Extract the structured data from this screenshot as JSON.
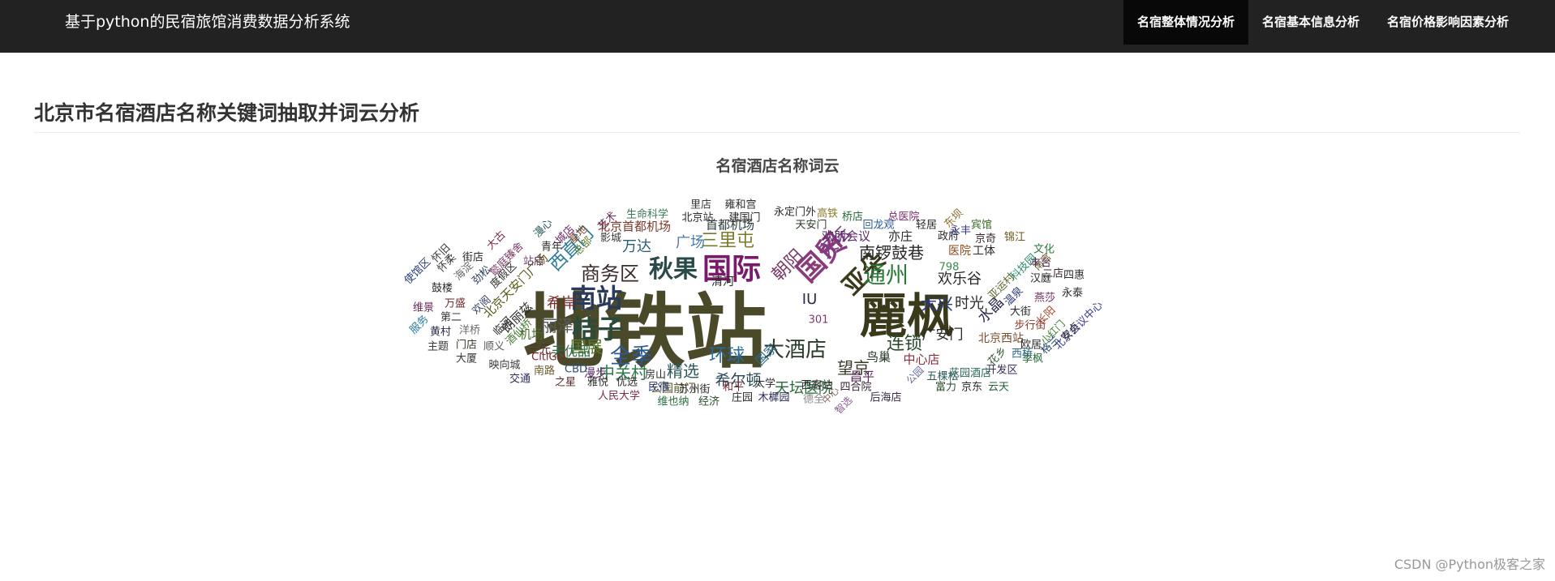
{
  "header": {
    "brand": "基于python的民宿旅馆消费数据分析系统",
    "nav": [
      {
        "label": "名宿整体情况分析"
      },
      {
        "label": "名宿基本信息分析"
      },
      {
        "label": "名宿价格影响因素分析"
      }
    ],
    "active_nav": 0
  },
  "main": {
    "title": "北京市名宿酒店名称关键词抽取并词云分析"
  },
  "chart_data": {
    "type": "wordcloud",
    "title": "名宿酒店名称词云",
    "words": [
      {
        "text": "地铁站",
        "weight": 100,
        "color": "#4a4a2a"
      },
      {
        "text": "麗枫",
        "weight": 58,
        "color": "#3a3a1a"
      },
      {
        "text": "国际",
        "weight": 36,
        "color": "#7a1a6a"
      },
      {
        "text": "国贸",
        "weight": 34,
        "color": "#8a3a7a"
      },
      {
        "text": "亚朵",
        "weight": 30,
        "color": "#3a3a1a"
      },
      {
        "text": "南站",
        "weight": 32,
        "color": "#2a3a5a"
      },
      {
        "text": "桔子",
        "weight": 32,
        "color": "#2a4a3a"
      },
      {
        "text": "秋果",
        "weight": 30,
        "color": "#2a4a4a"
      },
      {
        "text": "商务区",
        "weight": 24,
        "color": "#3a2a2a"
      },
      {
        "text": "通州",
        "weight": 28,
        "color": "#2a7a3a"
      },
      {
        "text": "全季",
        "weight": 26,
        "color": "#2a5a9a"
      },
      {
        "text": "大酒店",
        "weight": 26,
        "color": "#2a3a2a"
      },
      {
        "text": "三里屯",
        "weight": 22,
        "color": "#7a7a2a"
      },
      {
        "text": "朝阳",
        "weight": 22,
        "color": "#7a3a6a"
      },
      {
        "text": "天坛",
        "weight": 22,
        "color": "#7a3a8a"
      },
      {
        "text": "西直门",
        "weight": 22,
        "color": "#2a7a9a"
      },
      {
        "text": "南锣鼓巷",
        "weight": 20,
        "color": "#2a2a2a"
      },
      {
        "text": "大兴",
        "weight": 20,
        "color": "#2a3a8a"
      },
      {
        "text": "环球",
        "weight": 22,
        "color": "#2a6a9a"
      },
      {
        "text": "连锁",
        "weight": 22,
        "color": "#2a4a2a"
      },
      {
        "text": "丽泽",
        "weight": 20,
        "color": "#5a5a5a"
      },
      {
        "text": "国展",
        "weight": 20,
        "color": "#5a7a2a"
      },
      {
        "text": "中关村",
        "weight": 20,
        "color": "#2a7a4a"
      },
      {
        "text": "精选",
        "weight": 20,
        "color": "#2a5a5a"
      },
      {
        "text": "希尔顿",
        "weight": 19,
        "color": "#2a4a5a"
      },
      {
        "text": "望京",
        "weight": 20,
        "color": "#3a3a2a"
      },
      {
        "text": "万达",
        "weight": 18,
        "color": "#2a5a7a"
      },
      {
        "text": "广场",
        "weight": 18,
        "color": "#4a7aaa"
      },
      {
        "text": "水晶",
        "weight": 18,
        "color": "#2a2a4a"
      },
      {
        "text": "欢乐谷",
        "weight": 18,
        "color": "#2a2a2a"
      },
      {
        "text": "时光",
        "weight": 18,
        "color": "#2a2a2a"
      },
      {
        "text": "希岸",
        "weight": 18,
        "color": "#7a2a2a"
      },
      {
        "text": "天坛医院",
        "weight": 18,
        "color": "#2a6a3a"
      },
      {
        "text": "广安门",
        "weight": 17,
        "color": "#2a2a2a"
      },
      {
        "text": "天优品",
        "weight": 16,
        "color": "#2a6a4a"
      },
      {
        "text": "北京首都机场",
        "weight": 15,
        "color": "#7a3a2a"
      },
      {
        "text": "首都机场",
        "weight": 15,
        "color": "#2a3a3a"
      },
      {
        "text": "欢朋会议",
        "weight": 15,
        "color": "#5a2a6a"
      },
      {
        "text": "亦庄",
        "weight": 15,
        "color": "#2a2a2a"
      },
      {
        "text": "北京天安门广场",
        "weight": 15,
        "color": "#5a5a1a"
      },
      {
        "text": "朗丽兹",
        "weight": 15,
        "color": "#2a2a2a"
      },
      {
        "text": "机场",
        "weight": 15,
        "color": "#4a6a2a"
      },
      {
        "text": "中心店",
        "weight": 15,
        "color": "#8a2a3a"
      },
      {
        "text": "鸟巢",
        "weight": 15,
        "color": "#2a3a2a"
      },
      {
        "text": "昌平",
        "weight": 15,
        "color": "#5a2a5a"
      },
      {
        "text": "北京西站",
        "weight": 14,
        "color": "#7a4a2a"
      },
      {
        "text": "国家",
        "weight": 15,
        "color": "#2a6a8a"
      },
      {
        "text": "公园前门",
        "weight": 14,
        "color": "#5a5a2a"
      },
      {
        "text": "漫步",
        "weight": 14,
        "color": "#5a2a6a"
      },
      {
        "text": "三元",
        "weight": 14,
        "color": "#5a2a2a"
      },
      {
        "text": "工体",
        "weight": 14,
        "color": "#2a2a2a"
      },
      {
        "text": "医院",
        "weight": 14,
        "color": "#8a4a1a"
      },
      {
        "text": "政府",
        "weight": 13,
        "color": "#2a2a2a"
      },
      {
        "text": "轻居",
        "weight": 13,
        "color": "#2a2a2a"
      },
      {
        "text": "总医院",
        "weight": 13,
        "color": "#7a2a6a"
      },
      {
        "text": "回龙观",
        "weight": 13,
        "color": "#2a5a9a"
      },
      {
        "text": "桥店",
        "weight": 13,
        "color": "#2a6a3a"
      },
      {
        "text": "高铁",
        "weight": 13,
        "color": "#8a7a2a"
      },
      {
        "text": "东坝",
        "weight": 13,
        "color": "#8a6a2a"
      },
      {
        "text": "宾馆",
        "weight": 13,
        "color": "#3a6a2a"
      },
      {
        "text": "永丰",
        "weight": 13,
        "color": "#3a3a8a"
      },
      {
        "text": "京奇",
        "weight": 13,
        "color": "#3a2a2a"
      },
      {
        "text": "锦江",
        "weight": 13,
        "color": "#6a5a1a"
      },
      {
        "text": "文化",
        "weight": 13,
        "color": "#2a7a3a"
      },
      {
        "text": "南宫",
        "weight": 12,
        "color": "#6a5a2a"
      },
      {
        "text": "科技园",
        "weight": 13,
        "color": "#2a8a6a"
      },
      {
        "text": "丰台",
        "weight": 13,
        "color": "#5a2a5a"
      },
      {
        "text": "亚运村",
        "weight": 13,
        "color": "#5a6a2a"
      },
      {
        "text": "汉庭",
        "weight": 13,
        "color": "#2a2a2a"
      },
      {
        "text": "二店",
        "weight": 13,
        "color": "#3a2a2a"
      },
      {
        "text": "四惠",
        "weight": 13,
        "color": "#2a2a2a"
      },
      {
        "text": "温泉",
        "weight": 13,
        "color": "#2a3a7a"
      },
      {
        "text": "燕莎",
        "weight": 13,
        "color": "#6a2a5a"
      },
      {
        "text": "永泰",
        "weight": 13,
        "color": "#2a2a2a"
      },
      {
        "text": "长阳",
        "weight": 13,
        "color": "#aa4a2a"
      },
      {
        "text": "大街",
        "weight": 13,
        "color": "#2a2a2a"
      },
      {
        "text": "步行街",
        "weight": 13,
        "color": "#8a3a2a"
      },
      {
        "text": "北京会议中心",
        "weight": 13,
        "color": "#3a3a9a"
      },
      {
        "text": "小红门",
        "weight": 12,
        "color": "#3a7a2a"
      },
      {
        "text": "格兰",
        "weight": 13,
        "color": "#2a4a6a"
      },
      {
        "text": "安贞",
        "weight": 13,
        "color": "#2a2a2a"
      },
      {
        "text": "欧居",
        "weight": 13,
        "color": "#2a2a2a"
      },
      {
        "text": "季枫",
        "weight": 13,
        "color": "#2a6a3a"
      },
      {
        "text": "开发区",
        "weight": 13,
        "color": "#3a2a5a"
      },
      {
        "text": "云天",
        "weight": 13,
        "color": "#2a5a3a"
      },
      {
        "text": "京东",
        "weight": 13,
        "color": "#2a2a2a"
      },
      {
        "text": "富力",
        "weight": 13,
        "color": "#2a4a2a"
      },
      {
        "text": "花园酒店",
        "weight": 13,
        "color": "#2a6a5a"
      },
      {
        "text": "西桥",
        "weight": 13,
        "color": "#2a6a8a"
      },
      {
        "text": "花乡",
        "weight": 13,
        "color": "#3a5a3a"
      },
      {
        "text": "五棵松",
        "weight": 13,
        "color": "#2a5a5a"
      },
      {
        "text": "公园",
        "weight": 12,
        "color": "#6a6a9a"
      },
      {
        "text": "后海店",
        "weight": 13,
        "color": "#3a2a4a"
      },
      {
        "text": "智选",
        "weight": 12,
        "color": "#8a5a8a"
      },
      {
        "text": "中心",
        "weight": 12,
        "color": "#8a6a6a"
      },
      {
        "text": "德全",
        "weight": 13,
        "color": "#8a8a8a"
      },
      {
        "text": "木樨园",
        "weight": 13,
        "color": "#2a2a5a"
      },
      {
        "text": "四合院",
        "weight": 13,
        "color": "#3a2a3a"
      },
      {
        "text": "西客站",
        "weight": 13,
        "color": "#2a2a2a"
      },
      {
        "text": "大学",
        "weight": 13,
        "color": "#2a2a2a"
      },
      {
        "text": "庄园",
        "weight": 13,
        "color": "#2a2a2a"
      },
      {
        "text": "经济",
        "weight": 13,
        "color": "#2a4a2a"
      },
      {
        "text": "维也纳",
        "weight": 13,
        "color": "#2a6a3a"
      },
      {
        "text": "和平",
        "weight": 13,
        "color": "#7a2a3a"
      },
      {
        "text": "苏州街",
        "weight": 13,
        "color": "#2a2a2a"
      },
      {
        "text": "民宿",
        "weight": 13,
        "color": "#2a3a7a"
      },
      {
        "text": "人民大学",
        "weight": 13,
        "color": "#7a2a4a"
      },
      {
        "text": "房山",
        "weight": 13,
        "color": "#2a2a2a"
      },
      {
        "text": "优选",
        "weight": 13,
        "color": "#2a2a2a"
      },
      {
        "text": "雅悦",
        "weight": 13,
        "color": "#2a2a2a"
      },
      {
        "text": "之星",
        "weight": 13,
        "color": "#5a2a2a"
      },
      {
        "text": "交通",
        "weight": 13,
        "color": "#2a2a5a"
      },
      {
        "text": "南路",
        "weight": 13,
        "color": "#6a5a2a"
      },
      {
        "text": "CBD",
        "weight": 13,
        "color": "#2a4a7a"
      },
      {
        "text": "映向城",
        "weight": 13,
        "color": "#3a3a3a"
      },
      {
        "text": "CitiGO",
        "weight": 13,
        "color": "#7a2a2a"
      },
      {
        "text": "大厦",
        "weight": 13,
        "color": "#3a3a3a"
      },
      {
        "text": "顺义",
        "weight": 13,
        "color": "#5a5a5a"
      },
      {
        "text": "门店",
        "weight": 13,
        "color": "#3a3a2a"
      },
      {
        "text": "主题",
        "weight": 13,
        "color": "#3a3a3a"
      },
      {
        "text": "黄村",
        "weight": 13,
        "color": "#2a2a4a"
      },
      {
        "text": "洋桥",
        "weight": 13,
        "color": "#6a6a6a"
      },
      {
        "text": "服务",
        "weight": 13,
        "color": "#2a7a9a"
      },
      {
        "text": "第二",
        "weight": 13,
        "color": "#3a3a3a"
      },
      {
        "text": "维景",
        "weight": 13,
        "color": "#6a2a5a"
      },
      {
        "text": "万盛",
        "weight": 13,
        "color": "#6a2a2a"
      },
      {
        "text": "鼓楼",
        "weight": 13,
        "color": "#2a2a2a"
      },
      {
        "text": "欢阁",
        "weight": 13,
        "color": "#3a4a6a"
      },
      {
        "text": "临河",
        "weight": 13,
        "color": "#2a2a2a"
      },
      {
        "text": "酒仙桥",
        "weight": 13,
        "color": "#4a7a3a"
      },
      {
        "text": "度假区",
        "weight": 13,
        "color": "#2a2a2a"
      },
      {
        "text": "劲松",
        "weight": 13,
        "color": "#2a3a5a"
      },
      {
        "text": "懿庭臻舍",
        "weight": 13,
        "color": "#7a3a6a"
      },
      {
        "text": "海淀",
        "weight": 13,
        "color": "#6a6a6a"
      },
      {
        "text": "怀柔",
        "weight": 13,
        "color": "#3a3a3a"
      },
      {
        "text": "使馆区",
        "weight": 13,
        "color": "#2a3a7a"
      },
      {
        "text": "怀旧",
        "weight": 13,
        "color": "#3a3a3a"
      },
      {
        "text": "街店",
        "weight": 13,
        "color": "#2a2a2a"
      },
      {
        "text": "大古",
        "weight": 13,
        "color": "#7a2a4a"
      },
      {
        "text": "漫心",
        "weight": 13,
        "color": "#2a5a5a"
      },
      {
        "text": "城店",
        "weight": 13,
        "color": "#6a2a6a"
      },
      {
        "text": "基地",
        "weight": 13,
        "color": "#7a4a2a"
      },
      {
        "text": "站店",
        "weight": 13,
        "color": "#6a3a6a"
      },
      {
        "text": "青年",
        "weight": 13,
        "color": "#2a2a2a"
      },
      {
        "text": "总部",
        "weight": 13,
        "color": "#5a7a2a"
      },
      {
        "text": "影城",
        "weight": 13,
        "color": "#3a3a3a"
      },
      {
        "text": "艺术",
        "weight": 13,
        "color": "#6a2a5a"
      },
      {
        "text": "生命科学",
        "weight": 13,
        "color": "#3a7a5a"
      },
      {
        "text": "北京站",
        "weight": 13,
        "color": "#2a2a2a"
      },
      {
        "text": "里店",
        "weight": 13,
        "color": "#3a3a3a"
      },
      {
        "text": "雍和宫",
        "weight": 13,
        "color": "#2a2a2a"
      },
      {
        "text": "建国门",
        "weight": 13,
        "color": "#2a2a2a"
      },
      {
        "text": "永定门外",
        "weight": 13,
        "color": "#2a2a2a"
      },
      {
        "text": "天安门",
        "weight": 13,
        "color": "#2a3a2a"
      },
      {
        "text": "798",
        "weight": 13,
        "color": "#3a8a4a"
      },
      {
        "text": "301",
        "weight": 13,
        "color": "#7a3a6a"
      },
      {
        "text": "IU",
        "weight": 18,
        "color": "#2a2a4a"
      },
      {
        "text": "清河",
        "weight": 14,
        "color": "#2a2a2a"
      }
    ]
  },
  "footer": {
    "watermark": "CSDN @Python极客之家"
  }
}
